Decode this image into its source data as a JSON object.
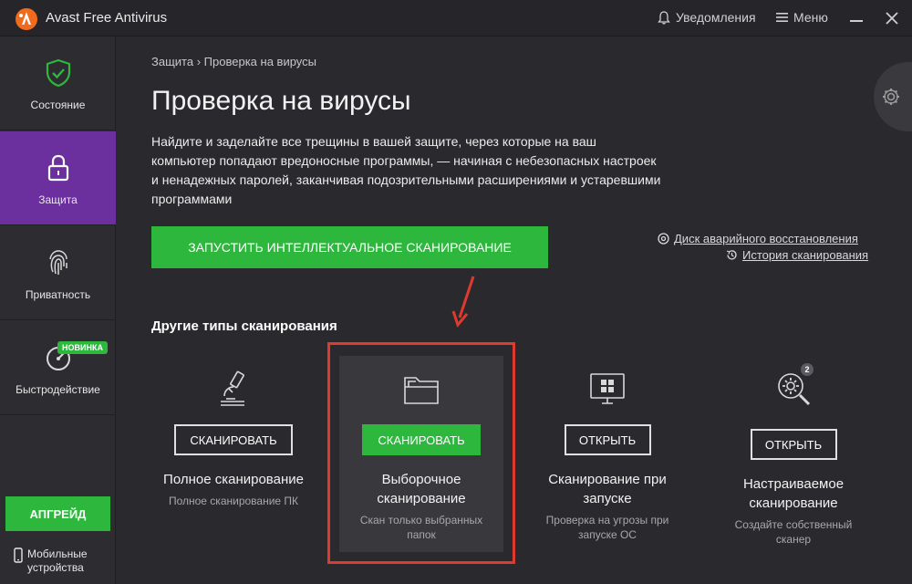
{
  "app": {
    "title": "Avast Free Antivirus"
  },
  "titlebar": {
    "notifications": "Уведомления",
    "menu": "Меню"
  },
  "sidebar": {
    "items": [
      {
        "label": "Состояние"
      },
      {
        "label": "Защита"
      },
      {
        "label": "Приватность"
      },
      {
        "label": "Быстродействие",
        "badge": "НОВИНКА"
      }
    ],
    "upgrade": "АПГРЕЙД",
    "mobile": "Мобильные устройства"
  },
  "main": {
    "breadcrumb": {
      "parent": "Защита",
      "separator": "›",
      "current": "Проверка на вирусы"
    },
    "title": "Проверка на вирусы",
    "description": "Найдите и заделайте все трещины в вашей защите, через которые на ваш компьютер попадают вредоносные программы, — начиная с небезопасных настроек и ненадежных паролей, заканчивая подозрительными расширениями и устаревшими программами",
    "smart_scan": "ЗАПУСТИТЬ ИНТЕЛЛЕКТУАЛЬНОЕ СКАНИРОВАНИЕ",
    "links": {
      "rescue_disk": "Диск аварийного восстановления",
      "history": "История сканирования"
    },
    "other_title": "Другие типы сканирования",
    "cards": [
      {
        "button": "СКАНИРОВАТЬ",
        "title": "Полное сканирование",
        "desc": "Полное сканирование ПК"
      },
      {
        "button": "СКАНИРОВАТЬ",
        "title": "Выборочное сканирование",
        "desc": "Скан только выбранных папок"
      },
      {
        "button": "ОТКРЫТЬ",
        "title": "Сканирование при запуске",
        "desc": "Проверка на угрозы при запуске ОС"
      },
      {
        "button": "ОТКРЫТЬ",
        "title": "Настраиваемое сканирование",
        "desc": "Создайте собственный сканер",
        "badge": "2"
      }
    ]
  },
  "colors": {
    "accent_green": "#2db83d",
    "active_purple": "#6b2f9e",
    "brand_orange": "#f26b1d",
    "highlight_red": "#e03a2e"
  },
  "icons": [
    "avast-logo-icon",
    "bell-icon",
    "hamburger-icon",
    "shield-check-icon",
    "lock-icon",
    "fingerprint-icon",
    "speedometer-icon",
    "phone-icon",
    "gear-icon",
    "rescue-disk-icon",
    "history-icon",
    "microscope-icon",
    "folder-icon",
    "windows-monitor-icon",
    "custom-scan-gear-icon"
  ]
}
